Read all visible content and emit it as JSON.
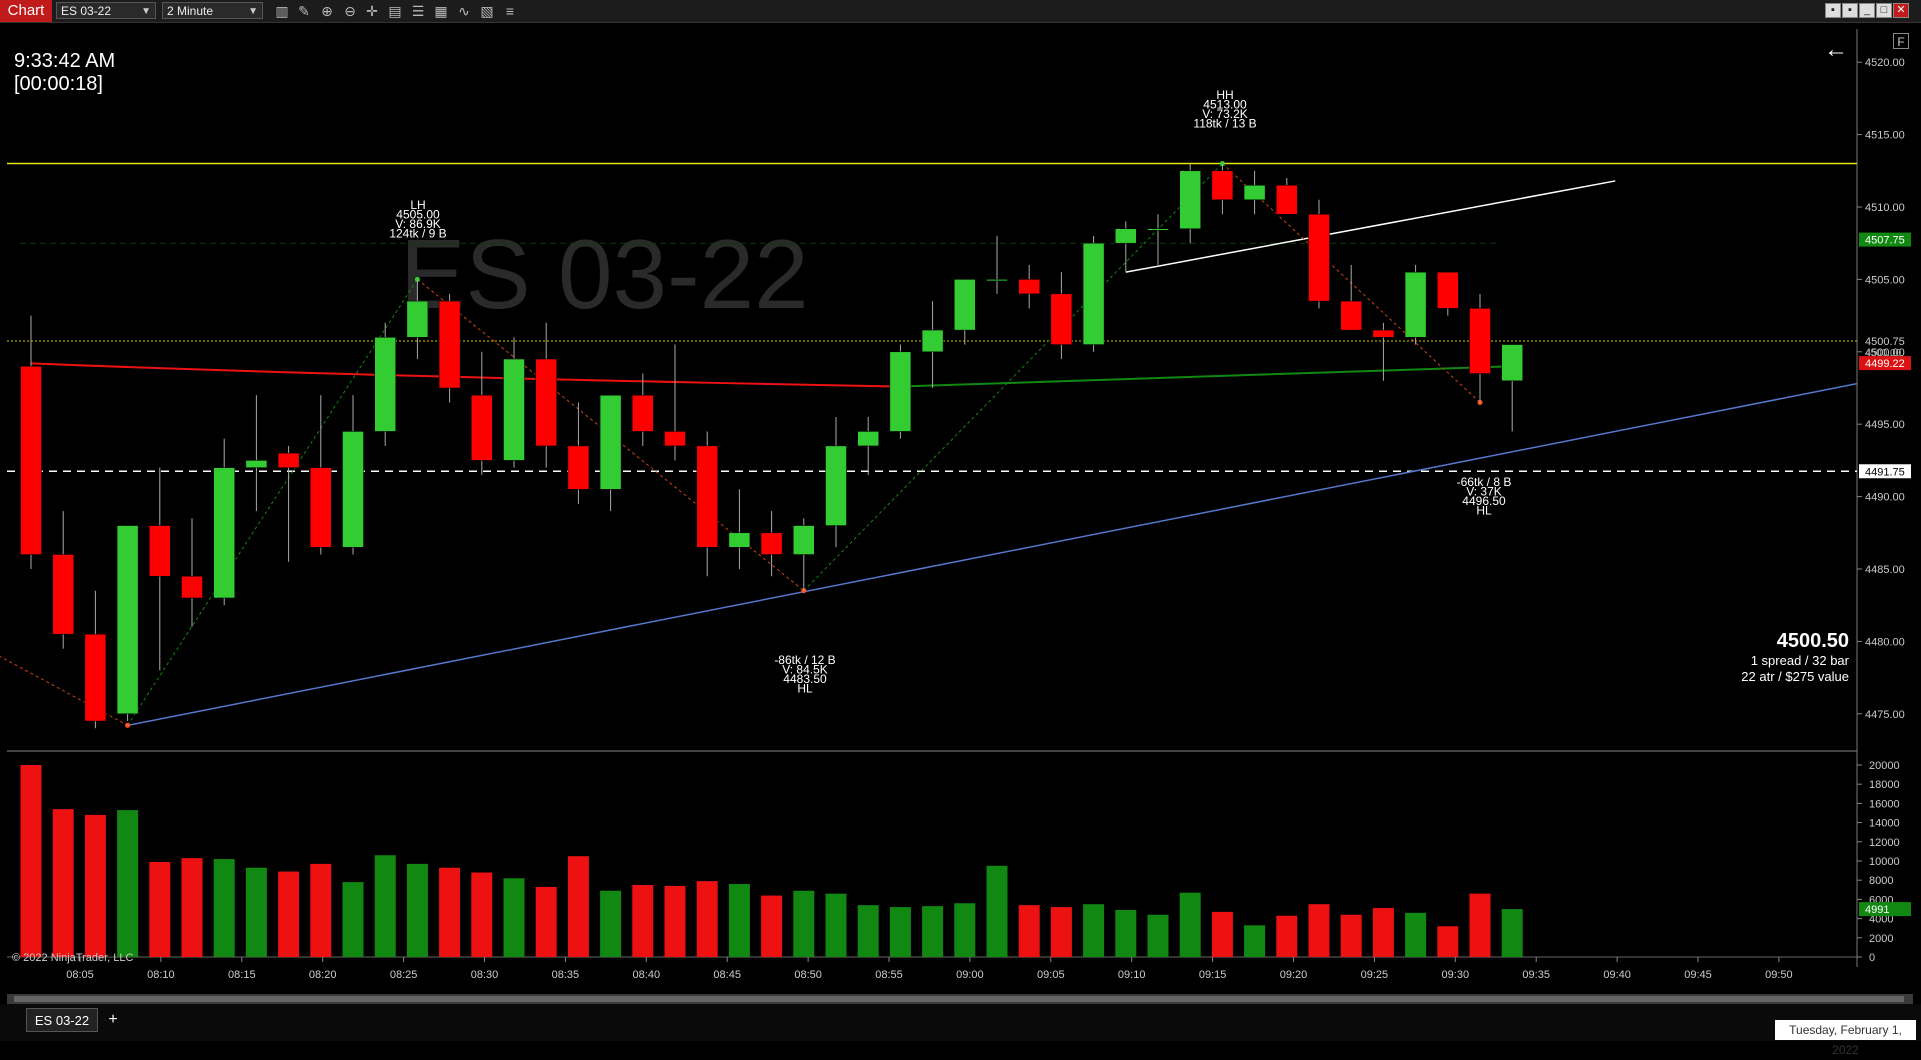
{
  "toolbar": {
    "chart_label": "Chart",
    "instrument_value": "ES 03-22",
    "interval_value": "2 Minute",
    "icons": [
      "bar-type-icon",
      "draw-icon",
      "zoom-in-icon",
      "zoom-out-icon",
      "crosshair-icon",
      "data-box-icon",
      "properties-icon",
      "indicators-icon",
      "strategies-icon",
      "templates-icon",
      "list-icon"
    ]
  },
  "clock": {
    "time": "9:33:42 AM",
    "countdown": "[00:00:18]"
  },
  "watermark": "ES 03-22",
  "price_panel": {
    "price": "4500.50",
    "line1": "1 spread / 32 bar",
    "line2": "22 atr / $275 value"
  },
  "annotations": {
    "lh": [
      "LH",
      "4505.00",
      "V: 86.9K",
      "124tk / 9 B"
    ],
    "hh": [
      "HH",
      "4513.00",
      "V: 73.2K",
      "118tk / 13 B"
    ],
    "hl1": [
      "-86tk / 12 B",
      "V: 84.5K",
      "4483.50",
      "HL"
    ],
    "hl2": [
      "-66tk / 8 B",
      "V: 37K",
      "4496.50",
      "HL"
    ]
  },
  "price_axis": {
    "ticks": [
      "4520.00",
      "4515.00",
      "4510.00",
      "4505.00",
      "4500.00",
      "4495.00",
      "4490.00",
      "4485.00",
      "4480.00",
      "4475.00"
    ],
    "labels": {
      "green": "4507.75",
      "yellow": "4500.75",
      "current": "4500.00",
      "red": "4499.22",
      "white": "4491.75"
    }
  },
  "volume_axis": {
    "ticks": [
      "20000",
      "18000",
      "16000",
      "14000",
      "12000",
      "10000",
      "8000",
      "6000",
      "4000",
      "2000",
      "0"
    ],
    "current": "4991"
  },
  "time_axis": [
    "08:05",
    "08:10",
    "08:15",
    "08:20",
    "08:25",
    "08:30",
    "08:35",
    "08:40",
    "08:45",
    "08:50",
    "08:55",
    "09:00",
    "09:05",
    "09:10",
    "09:15",
    "09:20",
    "09:25",
    "09:30",
    "09:35",
    "09:40",
    "09:45",
    "09:50"
  ],
  "colors": {
    "up": "#33cc33",
    "down": "#ff0000",
    "vol_up": "#118811",
    "vol_down": "#ee1111",
    "accent": "#c01a1a"
  },
  "chart_data": {
    "type": "candlestick",
    "instrument": "ES 03-22",
    "interval": "2 Minute",
    "candles": [
      {
        "t": "08:04",
        "o": 4499.0,
        "h": 4502.5,
        "l": 4485.0,
        "c": 4486.0
      },
      {
        "t": "08:06",
        "o": 4486.0,
        "h": 4489.0,
        "l": 4479.5,
        "c": 4480.5
      },
      {
        "t": "08:08",
        "o": 4480.5,
        "h": 4483.5,
        "l": 4474.0,
        "c": 4474.5
      },
      {
        "t": "08:10",
        "o": 4475.0,
        "h": 4488.0,
        "l": 4474.5,
        "c": 4488.0
      },
      {
        "t": "08:12",
        "o": 4488.0,
        "h": 4492.0,
        "l": 4478.0,
        "c": 4484.5
      },
      {
        "t": "08:14",
        "o": 4484.5,
        "h": 4488.5,
        "l": 4481.0,
        "c": 4483.0
      },
      {
        "t": "08:16",
        "o": 4483.0,
        "h": 4494.0,
        "l": 4482.5,
        "c": 4492.0
      },
      {
        "t": "08:18",
        "o": 4492.0,
        "h": 4497.0,
        "l": 4489.0,
        "c": 4492.5
      },
      {
        "t": "08:20",
        "o": 4493.0,
        "h": 4493.5,
        "l": 4485.5,
        "c": 4492.0
      },
      {
        "t": "08:22",
        "o": 4492.0,
        "h": 4497.0,
        "l": 4486.0,
        "c": 4486.5
      },
      {
        "t": "08:24",
        "o": 4486.5,
        "h": 4497.0,
        "l": 4486.0,
        "c": 4494.5
      },
      {
        "t": "08:26",
        "o": 4494.5,
        "h": 4502.0,
        "l": 4493.5,
        "c": 4501.0
      },
      {
        "t": "08:28",
        "o": 4501.0,
        "h": 4505.0,
        "l": 4499.5,
        "c": 4503.5
      },
      {
        "t": "08:30",
        "o": 4503.5,
        "h": 4504.0,
        "l": 4496.5,
        "c": 4497.5
      },
      {
        "t": "08:32",
        "o": 4497.0,
        "h": 4500.0,
        "l": 4491.5,
        "c": 4492.5
      },
      {
        "t": "08:34",
        "o": 4492.5,
        "h": 4501.0,
        "l": 4492.0,
        "c": 4499.5
      },
      {
        "t": "08:36",
        "o": 4499.5,
        "h": 4502.0,
        "l": 4492.0,
        "c": 4493.5
      },
      {
        "t": "08:38",
        "o": 4493.5,
        "h": 4496.5,
        "l": 4489.5,
        "c": 4490.5
      },
      {
        "t": "08:40",
        "o": 4490.5,
        "h": 4497.0,
        "l": 4489.0,
        "c": 4497.0
      },
      {
        "t": "08:42",
        "o": 4497.0,
        "h": 4498.5,
        "l": 4493.5,
        "c": 4494.5
      },
      {
        "t": "08:44",
        "o": 4494.5,
        "h": 4500.5,
        "l": 4492.5,
        "c": 4493.5
      },
      {
        "t": "08:46",
        "o": 4493.5,
        "h": 4494.5,
        "l": 4484.5,
        "c": 4486.5
      },
      {
        "t": "08:48",
        "o": 4486.5,
        "h": 4490.5,
        "l": 4485.0,
        "c": 4487.5
      },
      {
        "t": "08:50",
        "o": 4487.5,
        "h": 4489.0,
        "l": 4484.5,
        "c": 4486.0
      },
      {
        "t": "08:52",
        "o": 4486.0,
        "h": 4488.5,
        "l": 4483.5,
        "c": 4488.0
      },
      {
        "t": "08:54",
        "o": 4488.0,
        "h": 4495.5,
        "l": 4486.5,
        "c": 4493.5
      },
      {
        "t": "08:56",
        "o": 4493.5,
        "h": 4495.5,
        "l": 4491.5,
        "c": 4494.5
      },
      {
        "t": "08:58",
        "o": 4494.5,
        "h": 4500.5,
        "l": 4494.0,
        "c": 4500.0
      },
      {
        "t": "09:00",
        "o": 4500.0,
        "h": 4503.5,
        "l": 4497.5,
        "c": 4501.5
      },
      {
        "t": "09:02",
        "o": 4501.5,
        "h": 4505.0,
        "l": 4500.5,
        "c": 4505.0
      },
      {
        "t": "09:04",
        "o": 4505.0,
        "h": 4508.0,
        "l": 4504.0,
        "c": 4505.0
      },
      {
        "t": "09:06",
        "o": 4505.0,
        "h": 4506.0,
        "l": 4503.0,
        "c": 4504.0
      },
      {
        "t": "09:08",
        "o": 4504.0,
        "h": 4505.5,
        "l": 4499.5,
        "c": 4500.5
      },
      {
        "t": "09:10",
        "o": 4500.5,
        "h": 4508.0,
        "l": 4500.0,
        "c": 4507.5
      },
      {
        "t": "09:12",
        "o": 4507.5,
        "h": 4509.0,
        "l": 4505.5,
        "c": 4508.5
      },
      {
        "t": "09:14",
        "o": 4508.5,
        "h": 4509.5,
        "l": 4506.0,
        "c": 4508.5
      },
      {
        "t": "09:16",
        "o": 4508.5,
        "h": 4513.0,
        "l": 4507.5,
        "c": 4512.5
      },
      {
        "t": "09:18",
        "o": 4512.5,
        "h": 4513.0,
        "l": 4509.5,
        "c": 4510.5
      },
      {
        "t": "09:20",
        "o": 4510.5,
        "h": 4512.5,
        "l": 4509.5,
        "c": 4511.5
      },
      {
        "t": "09:22",
        "o": 4511.5,
        "h": 4512.0,
        "l": 4509.5,
        "c": 4509.5
      },
      {
        "t": "09:24",
        "o": 4509.5,
        "h": 4510.5,
        "l": 4503.0,
        "c": 4503.5
      },
      {
        "t": "09:26",
        "o": 4503.5,
        "h": 4506.0,
        "l": 4501.5,
        "c": 4501.5
      },
      {
        "t": "09:28",
        "o": 4501.5,
        "h": 4502.0,
        "l": 4498.0,
        "c": 4501.0
      },
      {
        "t": "09:30",
        "o": 4501.0,
        "h": 4506.0,
        "l": 4500.5,
        "c": 4505.5
      },
      {
        "t": "09:32",
        "o": 4505.5,
        "h": 4505.5,
        "l": 4502.5,
        "c": 4503.0
      },
      {
        "t": "09:34",
        "o": 4503.0,
        "h": 4504.0,
        "l": 4496.5,
        "c": 4498.5
      },
      {
        "t": "09:34b",
        "o": 4498.0,
        "h": 4500.5,
        "l": 4494.5,
        "c": 4500.5
      }
    ],
    "volume": [
      20000,
      15400,
      14800,
      15300,
      9900,
      10300,
      10200,
      9300,
      8900,
      9700,
      7800,
      10600,
      9700,
      9300,
      8800,
      8200,
      7300,
      10500,
      6900,
      7500,
      7400,
      7900,
      7600,
      6400,
      6900,
      6600,
      5400,
      5200,
      5300,
      5600,
      9500,
      5400,
      5200,
      5500,
      4900,
      4400,
      6700,
      4700,
      3300,
      4300,
      5500,
      4400,
      5100,
      4600,
      3200,
      6600,
      4991
    ],
    "overlays": {
      "sma_red_start": 4499.0,
      "sma_red_end": 4497.5,
      "sma_green_start": 4497.5,
      "sma_green_end": 4499.0,
      "yellow_line": 4513.0,
      "dotted_yellow": 4500.75,
      "white_dashed": 4491.75
    },
    "ylim": [
      4472.5,
      4522.5
    ],
    "volume_ylim": [
      0,
      20000
    ]
  }
}
